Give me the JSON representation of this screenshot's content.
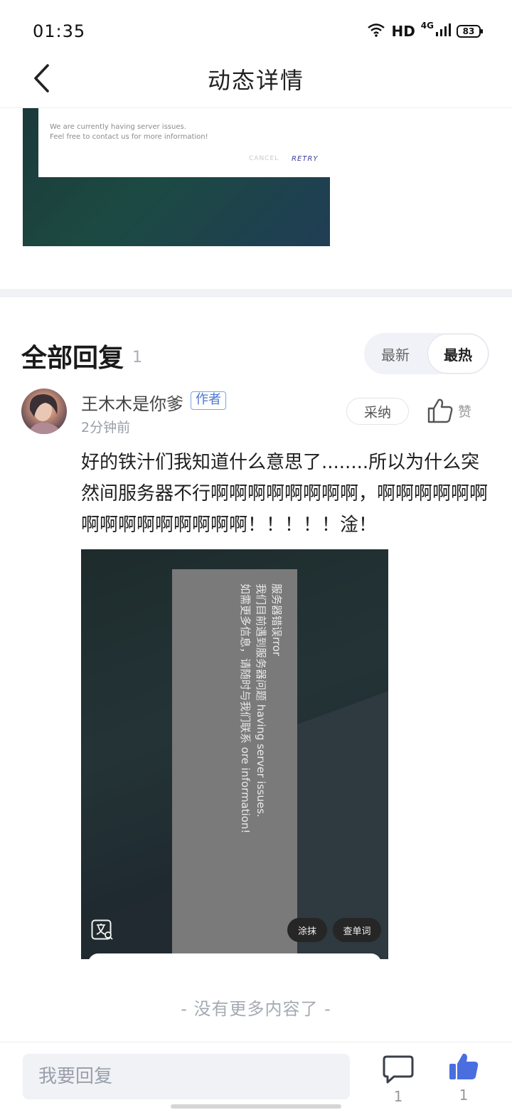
{
  "status_bar": {
    "time": "01:35",
    "network": "HD",
    "signal_type": "4G",
    "battery": "83",
    "icons": [
      "wifi-icon",
      "signal-icon",
      "battery-icon"
    ]
  },
  "header": {
    "title": "动态详情",
    "back_icon": "chevron-left-icon"
  },
  "post_image": {
    "dialog_message": "We are currently having server issues.\nFeel free to contact us for more information!",
    "dialog_cancel": "CANCEL",
    "dialog_retry": "RETRY"
  },
  "replies": {
    "title": "全部回复",
    "count": "1",
    "sort_options": [
      "最新",
      "最热"
    ],
    "selected_sort": "最热"
  },
  "comment": {
    "username": "王木木是你爹",
    "badge": "作者",
    "time": "2分钟前",
    "adopt_label": "采纳",
    "like_label": "赞",
    "text": "好的铁汁们我知道什么意思了........所以为什么突然间服务器不行啊啊啊啊啊啊啊啊，啊啊啊啊啊啊啊啊啊啊啊啊啊啊啊！！！！！淦！",
    "image": {
      "rotated_text": "服务器错误rror\n我们目前遇到服务器问题 having server issues.\n如需更多信息，请随时与我们联系 ore information!",
      "smear_label": "涂抹",
      "lookup_label": "查单词",
      "translate_icon": "translate-icon"
    }
  },
  "footer": {
    "no_more": "- 没有更多内容了 -"
  },
  "bottom_bar": {
    "reply_placeholder": "我要回复",
    "comment_count": "1",
    "like_count": "1"
  },
  "colors": {
    "accent_blue": "#4a6ee0",
    "divider": "#f1f2f5",
    "badge_border": "#7ea2e8"
  }
}
